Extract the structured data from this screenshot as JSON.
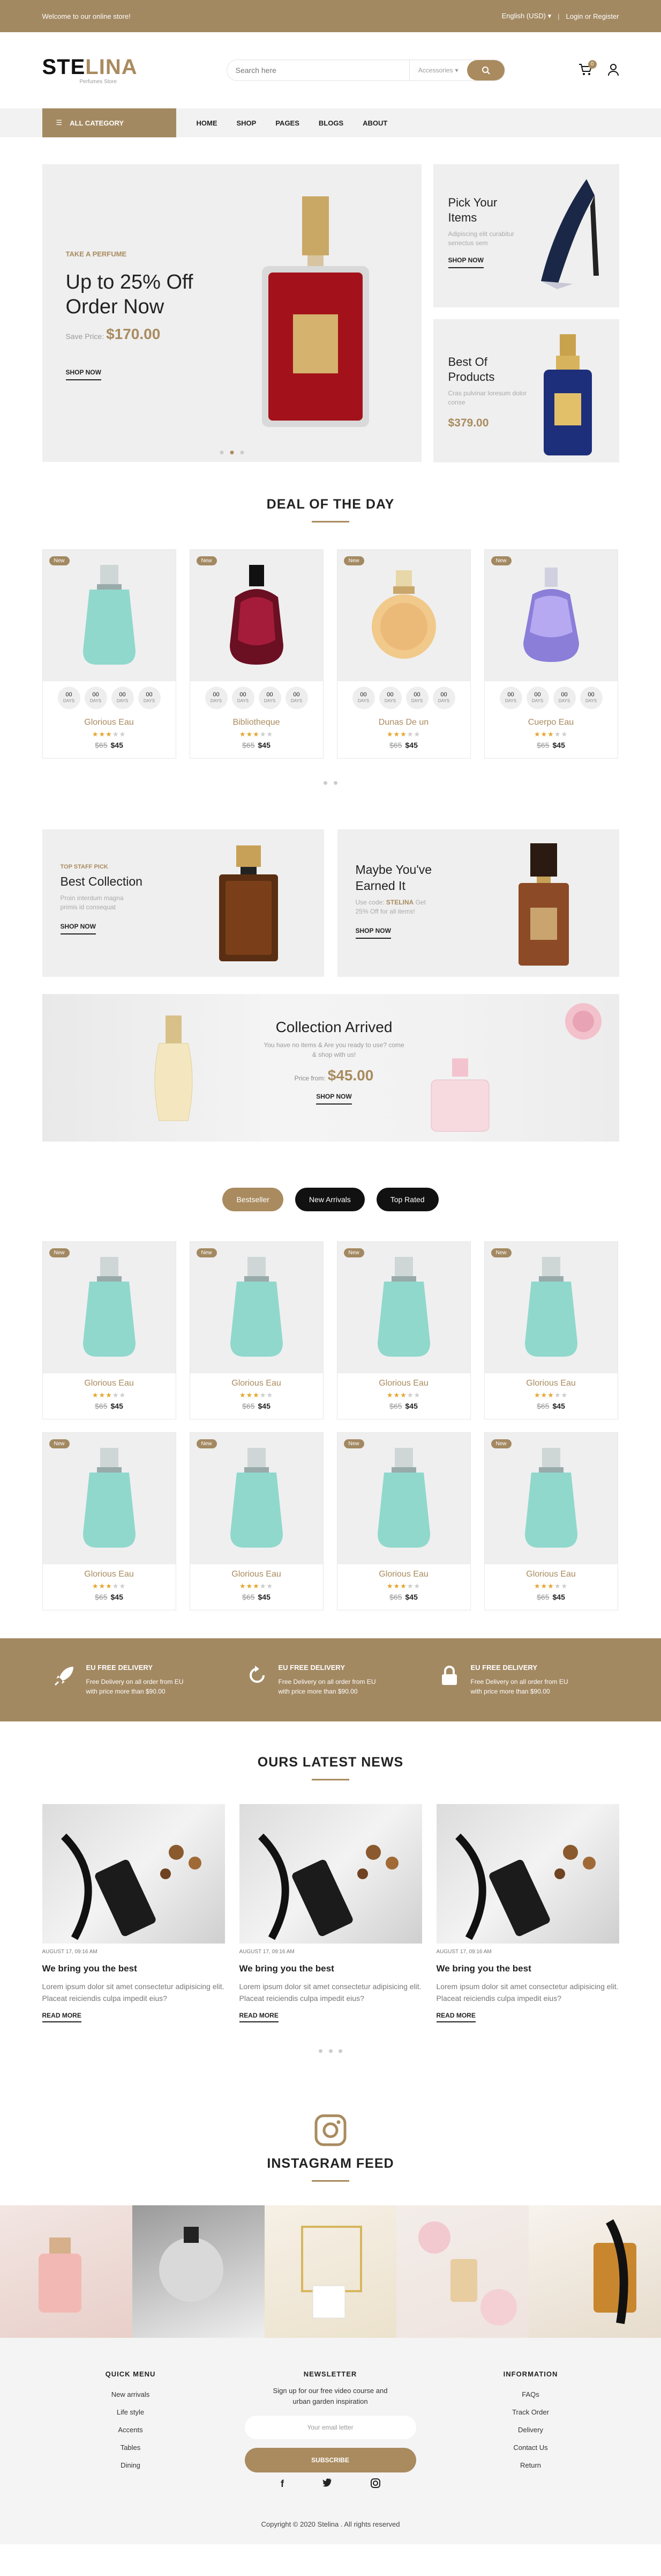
{
  "topbar": {
    "welcome": "Welcome to our online store!",
    "language": "English (USD)",
    "account": "Login or Register"
  },
  "header": {
    "logo_a": "STE",
    "logo_b": "LINA",
    "logo_sub": "Perfumes Store",
    "search_placeholder": "Search here",
    "category": "Accessories",
    "cart_count": "0"
  },
  "nav": {
    "all_category": "ALL CATEGORY",
    "items": [
      "HOME",
      "SHOP",
      "PAGES",
      "BLOGS",
      "ABOUT"
    ]
  },
  "hero": {
    "eyebrow": "TAKE A PERFUME",
    "title": "Up to 25% Off Order Now",
    "save_label": "Save Price:",
    "save_price": "$170.00",
    "cta": "SHOP NOW",
    "side1": {
      "title": "Pick Your Items",
      "desc": "Adipiscing elit curabitur senectus sem",
      "cta": "SHOP NOW"
    },
    "side2": {
      "title": "Best Of Products",
      "desc": "Cras pulvinar loresum dolor conse",
      "price": "$379.00"
    }
  },
  "deal": {
    "title": "DEAL OF THE DAY",
    "timer_value": "00",
    "timer_unit": "DAYS",
    "products": [
      {
        "tag": "New",
        "name": "Glorious Eau",
        "old": "$65",
        "price": "$45"
      },
      {
        "tag": "New",
        "name": "Bibliotheque",
        "old": "$65",
        "price": "$45"
      },
      {
        "tag": "New",
        "name": "Dunas De un",
        "old": "$65",
        "price": "$45"
      },
      {
        "tag": "New",
        "name": "Cuerpo Eau",
        "old": "$65",
        "price": "$45"
      }
    ]
  },
  "promos": {
    "p1": {
      "eyebrow": "TOP STAFF PICK",
      "title": "Best Collection",
      "desc": "Proin interdum magna primis id consequat",
      "cta": "SHOP NOW"
    },
    "p2": {
      "title": "Maybe You've Earned It",
      "desc_a": "Use code:",
      "code": "STELINA",
      "desc_b": "Get 25% Off for all items!",
      "cta": "SHOP NOW"
    },
    "collection": {
      "title": "Collection Arrived",
      "desc": "You have no items & Are you ready to use? come & shop with us!",
      "from_label": "Price from:",
      "price": "$45.00",
      "cta": "SHOP NOW"
    }
  },
  "tabs": {
    "bestseller": "Bestseller",
    "new_arrivals": "New Arrivals",
    "top_rated": "Top Rated"
  },
  "bestsellers": [
    {
      "tag": "New",
      "name": "Glorious Eau",
      "old": "$65",
      "price": "$45"
    },
    {
      "tag": "New",
      "name": "Glorious Eau",
      "old": "$65",
      "price": "$45"
    },
    {
      "tag": "New",
      "name": "Glorious Eau",
      "old": "$65",
      "price": "$45"
    },
    {
      "tag": "New",
      "name": "Glorious Eau",
      "old": "$65",
      "price": "$45"
    },
    {
      "tag": "New",
      "name": "Glorious Eau",
      "old": "$65",
      "price": "$45"
    },
    {
      "tag": "New",
      "name": "Glorious Eau",
      "old": "$65",
      "price": "$45"
    },
    {
      "tag": "New",
      "name": "Glorious Eau",
      "old": "$65",
      "price": "$45"
    },
    {
      "tag": "New",
      "name": "Glorious Eau",
      "old": "$65",
      "price": "$45"
    }
  ],
  "rating": 3,
  "features": [
    {
      "title": "EU FREE DELIVERY",
      "desc": "Free Delivery on all order from EU with price more than $90.00"
    },
    {
      "title": "EU FREE DELIVERY",
      "desc": "Free Delivery on all order from EU with price more than $90.00"
    },
    {
      "title": "EU FREE DELIVERY",
      "desc": "Free Delivery on all order from EU with price more than $90.00"
    }
  ],
  "news": {
    "title": "OURS LATEST NEWS",
    "posts": [
      {
        "date": "AUGUST 17, 09:16 AM",
        "title": "We bring you the best",
        "excerpt": "Lorem ipsum dolor sit amet consectetur adipisicing elit. Placeat reiciendis culpa impedit eius?",
        "cta": "READ MORE"
      },
      {
        "date": "AUGUST 17, 09:16 AM",
        "title": "We bring you the best",
        "excerpt": "Lorem ipsum dolor sit amet consectetur adipisicing elit. Placeat reiciendis culpa impedit eius?",
        "cta": "READ MORE"
      },
      {
        "date": "AUGUST 17, 09:16 AM",
        "title": "We bring you the best",
        "excerpt": "Lorem ipsum dolor sit amet consectetur adipisicing elit. Placeat reiciendis culpa impedit eius?",
        "cta": "READ MORE"
      }
    ]
  },
  "instagram": {
    "title": "INSTAGRAM FEED"
  },
  "footer": {
    "quick": {
      "title": "QUICK MENU",
      "items": [
        "New arrivals",
        "Life style",
        "Accents",
        "Tables",
        "Dining"
      ]
    },
    "newsletter": {
      "title": "NEWSLETTER",
      "desc": "Sign up for our free video course and urban garden inspiration",
      "placeholder": "Your email letter",
      "button": "SUBSCRIBE"
    },
    "info": {
      "title": "INFORMATION",
      "items": [
        "FAQs",
        "Track Order",
        "Delivery",
        "Contact Us",
        "Return"
      ]
    },
    "copyright": "Copyright © 2020 Stelina . All rights reserved"
  },
  "colors": {
    "accent": "#a98b5f",
    "band": "#a38962",
    "dark": "#111111"
  }
}
